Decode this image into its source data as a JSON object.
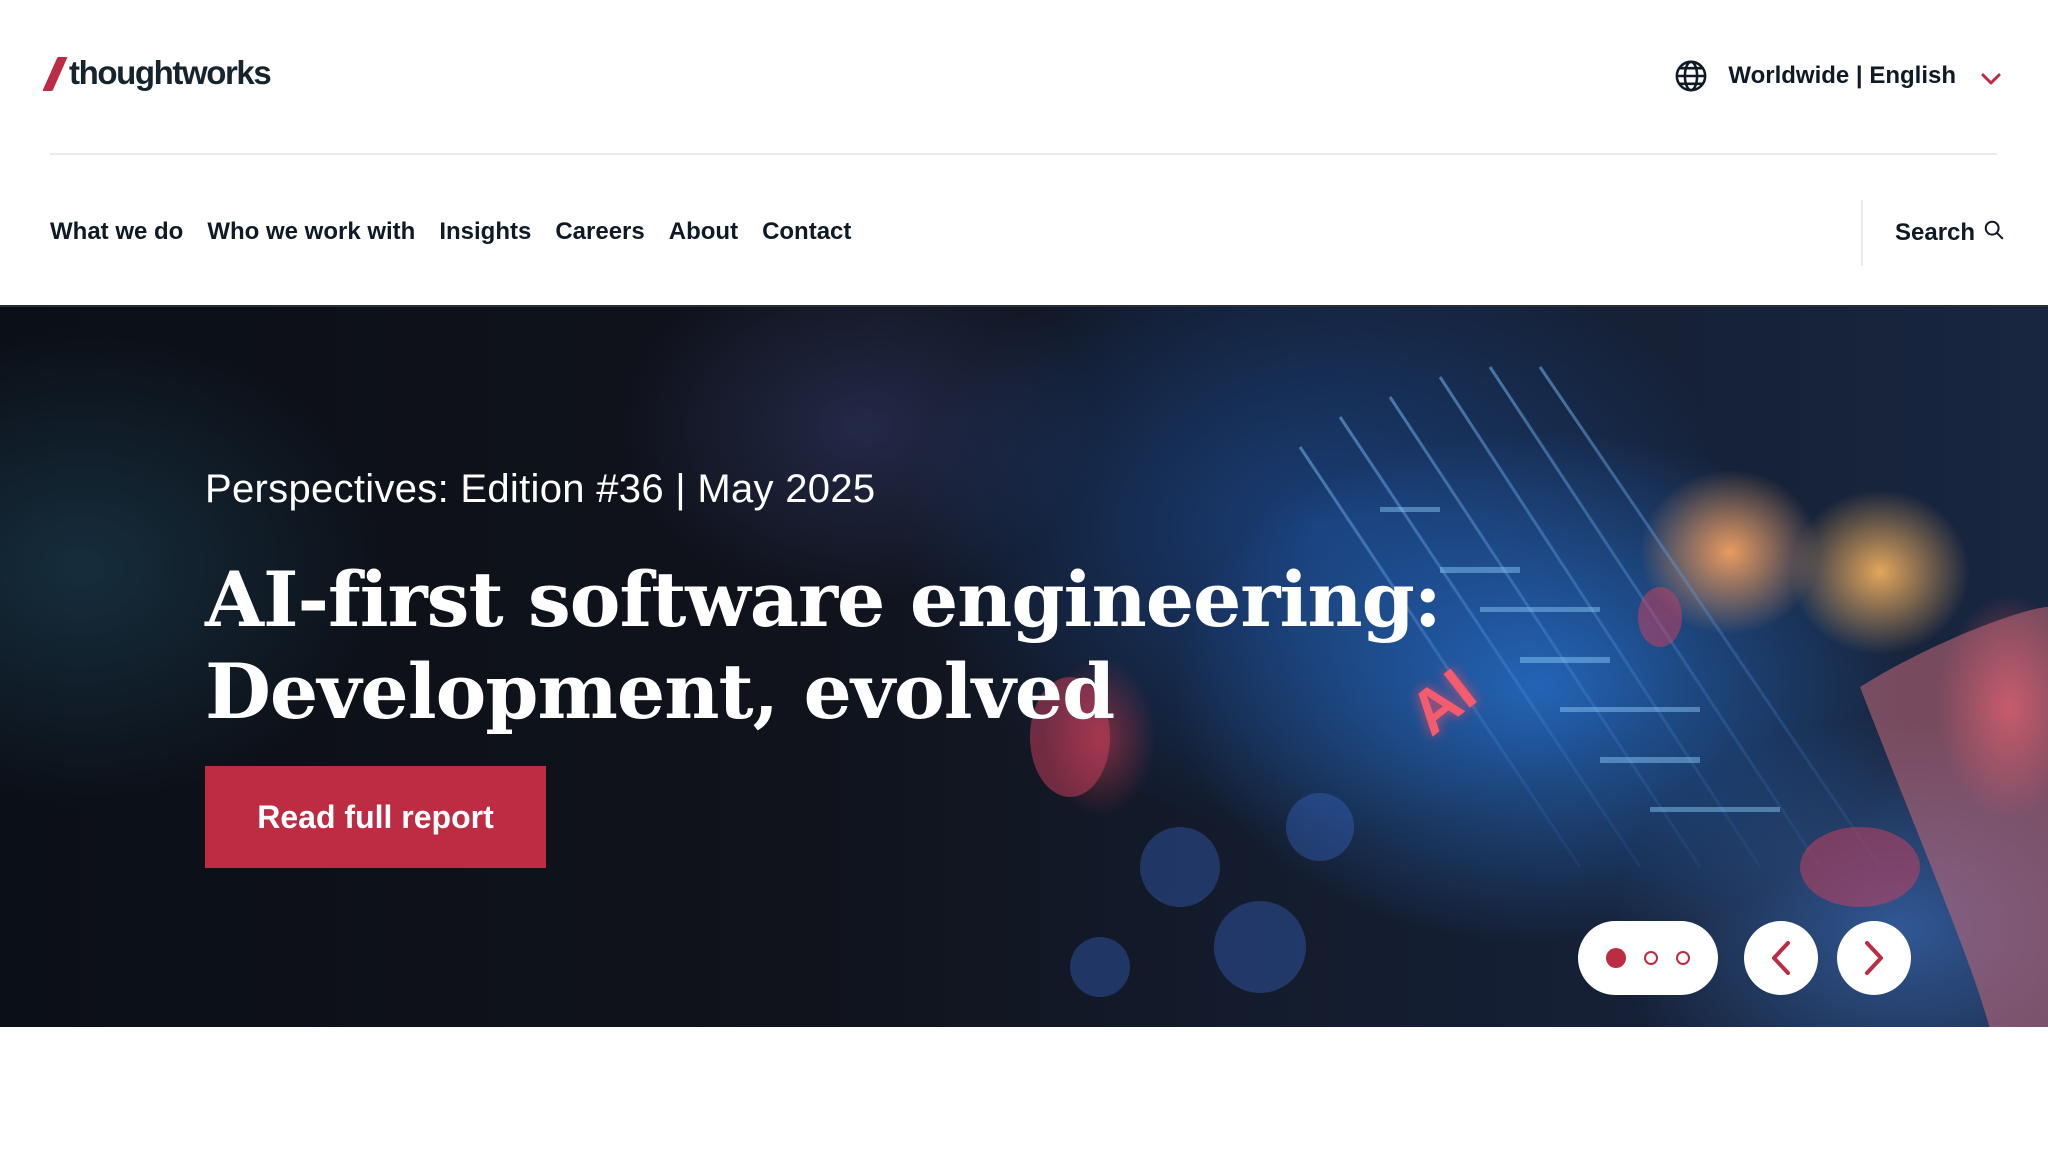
{
  "header": {
    "logo_text": "thoughtworks",
    "logo_icon": "thoughtworks-logo",
    "locale_label": "Worldwide | English",
    "locale_icon": "globe-icon",
    "locale_chevron_icon": "chevron-down-icon"
  },
  "nav": {
    "items": [
      {
        "label": "What we do"
      },
      {
        "label": "Who we work with"
      },
      {
        "label": "Insights"
      },
      {
        "label": "Careers"
      },
      {
        "label": "About"
      },
      {
        "label": "Contact"
      }
    ],
    "search_label": "Search",
    "search_icon": "search-icon"
  },
  "hero": {
    "eyebrow": "Perspectives: Edition #36 | May 2025",
    "title_line1": "AI-first software engineering:",
    "title_line2": "Development, evolved",
    "cta_label": "Read full report",
    "image_text": "AI",
    "slides_total": 3,
    "active_slide": 1,
    "prev_icon": "chevron-left-icon",
    "next_icon": "chevron-right-icon"
  },
  "colors": {
    "brand_accent": "#bd2c43",
    "text_primary": "#0f1a26",
    "divider": "#e8eaec",
    "hero_text": "#ffffff"
  }
}
